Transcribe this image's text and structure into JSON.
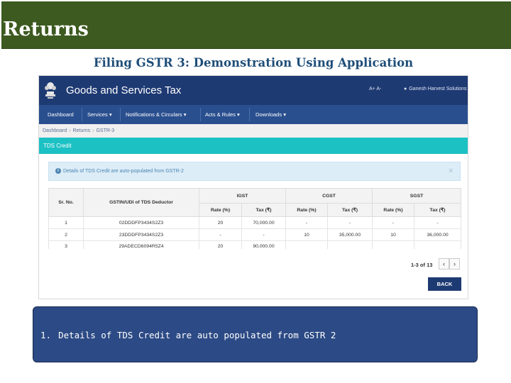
{
  "slide": {
    "title": "Returns",
    "subtitle": "Filing GSTR 3: Demonstration Using Application",
    "colors": {
      "header": "#3d5a20",
      "subtitle": "#1f4e79",
      "notes_box": "#2c4a85"
    }
  },
  "portal": {
    "brand": "Goods and Services Tax",
    "lang_switch": "A+ A-",
    "user_name": "Ganesh Harvest Solutions",
    "emblem_icon": "emblem-icon",
    "nav": [
      "Dashboard",
      "Services ▾",
      "Notifications & Circulars ▾",
      "Acts & Rules ▾",
      "Downloads ▾"
    ],
    "breadcrumb": [
      "Dashboard",
      "Returns",
      "GSTR-3"
    ],
    "section_title": "TDS Credit",
    "info_alert": "Details of TDS Credit are auto-populated from GSTR-2",
    "table": {
      "group_headers": [
        "Sr. No.",
        "GSTIN/UDI of TDS Deductor",
        "IGST",
        "CGST",
        "SGST"
      ],
      "sub_headers": [
        "Rate (%)",
        "Tax (₹)",
        "Rate (%)",
        "Tax (₹)",
        "Rate (%)",
        "Tax (₹)"
      ],
      "rows": [
        [
          "1",
          "02DDDFP3434S2Z3",
          "20",
          "70,000.00",
          "-",
          "-",
          "-",
          "-"
        ],
        [
          "2",
          "23DDDFP3434S2Z3",
          "-",
          "-",
          "10",
          "35,000.00",
          "10",
          "36,000.00"
        ],
        [
          "3",
          "29ADECD6094R5Z4",
          "20",
          "90,000.00",
          "",
          "",
          "",
          ""
        ]
      ]
    },
    "pager": {
      "text": "1-3 of 13",
      "prev": "‹",
      "next": "›"
    },
    "back_button": "BACK",
    "colors": {
      "topbar": "#1e3a73",
      "nav": "#2a4f8f",
      "section_bar": "#1cc1c4",
      "info_bg": "#dcedf7"
    }
  },
  "notes": [
    {
      "number": "1.",
      "text": "Details of TDS Credit are auto populated from GSTR 2"
    }
  ]
}
